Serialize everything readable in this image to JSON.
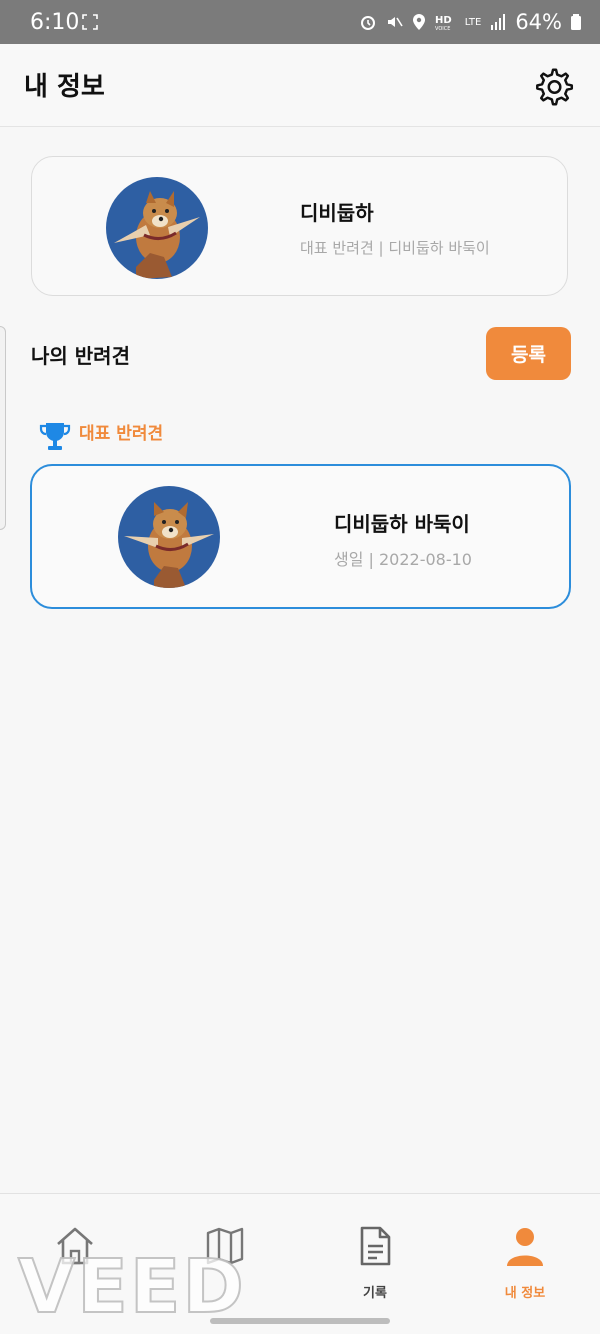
{
  "status_bar": {
    "time": "6:10",
    "network": "LTE",
    "battery": "64%"
  },
  "app_bar": {
    "title": "내 정보"
  },
  "profile": {
    "name": "디비둡하",
    "subtitle": "대표 반려견 | 디비둡하 바둑이"
  },
  "pets_section": {
    "title": "나의 반려견",
    "register_label": "등록"
  },
  "representative": {
    "label": "대표 반려견"
  },
  "pet_card": {
    "name": "디비둡하 바둑이",
    "subtitle": "생일 | 2022-08-10"
  },
  "bottom_nav": {
    "items": [
      {
        "label": "",
        "icon": "home-icon",
        "active": false
      },
      {
        "label": "",
        "icon": "map-icon",
        "active": false
      },
      {
        "label": "기록",
        "icon": "document-icon",
        "active": false
      },
      {
        "label": "내 정보",
        "icon": "person-icon",
        "active": true
      }
    ]
  },
  "watermark": "VEED",
  "colors": {
    "accent": "#f08a3c",
    "selection": "#2c8ddb",
    "trophy": "#1e88e5",
    "muted": "#a8a8a8"
  }
}
